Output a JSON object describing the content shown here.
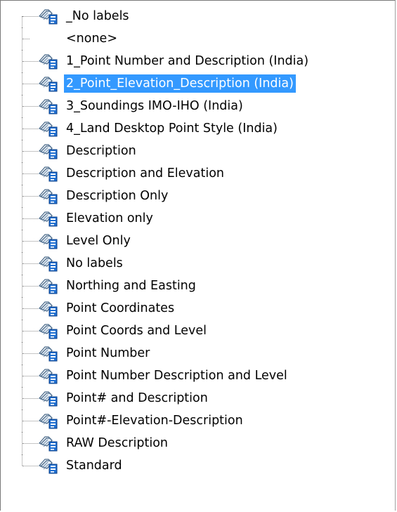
{
  "tree": {
    "selected_color": "#3399ff",
    "items": [
      {
        "label": "_No labels",
        "icon": "label-style-icon",
        "selected": false
      },
      {
        "label": "<none>",
        "icon": "",
        "selected": false
      },
      {
        "label": "1_Point Number and Description (India)",
        "icon": "label-style-icon",
        "selected": false
      },
      {
        "label": "2_Point_Elevation_Description (India)",
        "icon": "label-style-icon",
        "selected": true
      },
      {
        "label": "3_Soundings IMO-IHO (India)",
        "icon": "label-style-icon",
        "selected": false
      },
      {
        "label": "4_Land Desktop Point Style (India)",
        "icon": "label-style-icon",
        "selected": false
      },
      {
        "label": "Description",
        "icon": "label-style-icon",
        "selected": false
      },
      {
        "label": "Description and Elevation",
        "icon": "label-style-icon",
        "selected": false
      },
      {
        "label": "Description Only",
        "icon": "label-style-icon",
        "selected": false
      },
      {
        "label": "Elevation only",
        "icon": "label-style-icon",
        "selected": false
      },
      {
        "label": "Level Only",
        "icon": "label-style-icon",
        "selected": false
      },
      {
        "label": "No labels",
        "icon": "label-style-icon",
        "selected": false
      },
      {
        "label": "Northing and Easting",
        "icon": "label-style-icon",
        "selected": false
      },
      {
        "label": "Point Coordinates",
        "icon": "label-style-icon",
        "selected": false
      },
      {
        "label": "Point Coords and Level",
        "icon": "label-style-icon",
        "selected": false
      },
      {
        "label": "Point Number",
        "icon": "label-style-icon",
        "selected": false
      },
      {
        "label": "Point Number Description and Level",
        "icon": "label-style-icon",
        "selected": false
      },
      {
        "label": "Point# and Description",
        "icon": "label-style-icon",
        "selected": false
      },
      {
        "label": "Point#-Elevation-Description",
        "icon": "label-style-icon",
        "selected": false
      },
      {
        "label": "RAW Description",
        "icon": "label-style-icon",
        "selected": false
      },
      {
        "label": "Standard",
        "icon": "label-style-icon",
        "selected": false
      }
    ]
  }
}
